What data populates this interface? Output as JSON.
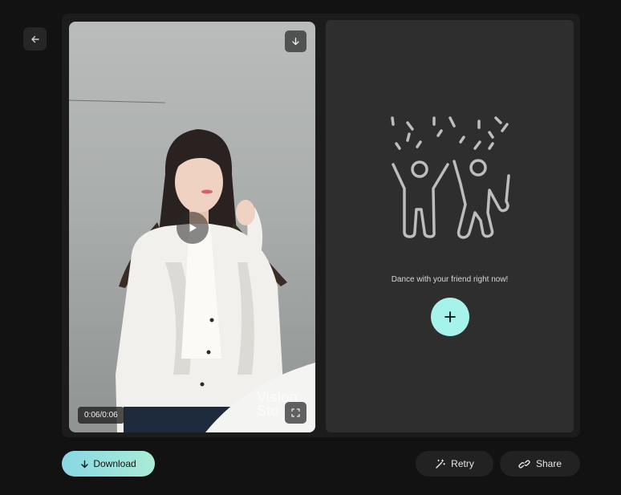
{
  "icons": {
    "back": "arrow-left-icon",
    "video_download": "arrow-down-icon",
    "play": "play-icon",
    "fullscreen": "fullscreen-icon",
    "add": "plus-icon",
    "download": "arrow-down-icon",
    "retry": "magic-wand-icon",
    "share": "link-icon"
  },
  "video": {
    "time": "0:06/0:06",
    "watermark_line1": "Vision",
    "watermark_line2": "Sto"
  },
  "friend_panel": {
    "prompt": "Dance with your friend right now!"
  },
  "actions": {
    "download_label": "Download",
    "retry_label": "Retry",
    "share_label": "Share"
  },
  "colors": {
    "accent_cyan": "#a5f3ea",
    "download_gradient_start": "#89d7e4",
    "download_gradient_end": "#a9ecd6",
    "page_bg": "#121212"
  }
}
